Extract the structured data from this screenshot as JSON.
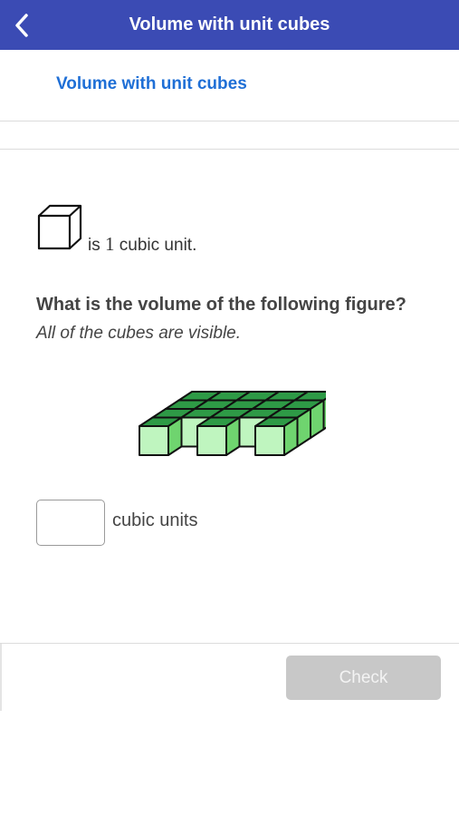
{
  "header": {
    "title": "Volume with unit cubes",
    "back_icon": "chevron-left-icon",
    "background_color": "#3b4bb4"
  },
  "subnav": {
    "link_label": "Volume with unit cubes",
    "link_color": "#1f6fd6"
  },
  "unit": {
    "icon": "unit-cube-icon",
    "prefix": "is",
    "number": "1",
    "suffix": "cubic unit."
  },
  "question": {
    "prompt": "What is the volume of the following figure?",
    "hint": "All of the cubes are visible."
  },
  "figure": {
    "icon": "cube-figure",
    "colors": {
      "top": "#2e9a46",
      "front": "#bff5bf",
      "side": "#6fd46f"
    }
  },
  "answer": {
    "value": "",
    "placeholder": "",
    "unit_label": "cubic units"
  },
  "footer": {
    "check_label": "Check",
    "check_color": "#c8c8c8"
  }
}
